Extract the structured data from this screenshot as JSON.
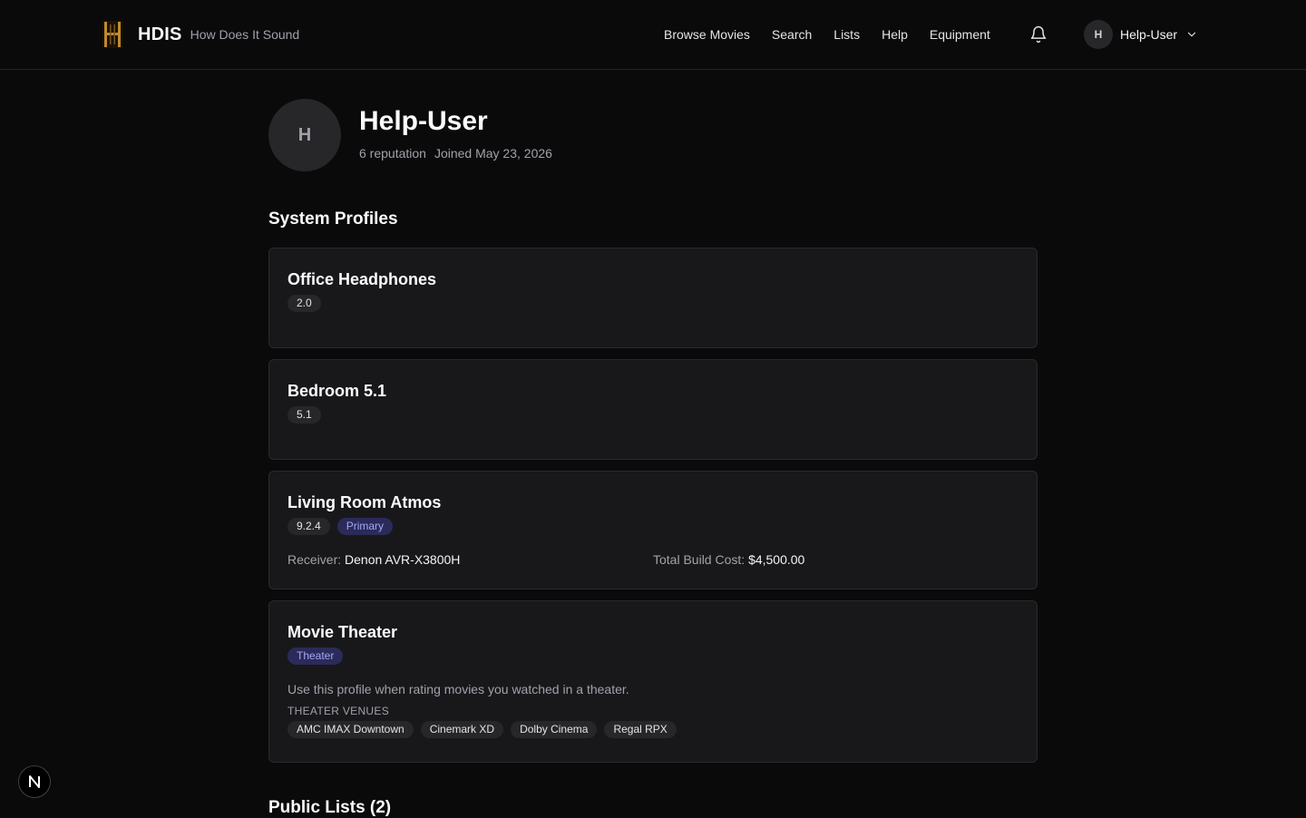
{
  "header": {
    "brand_name": "HDIS",
    "brand_tagline": "How Does It Sound",
    "nav": [
      {
        "label": "Browse Movies"
      },
      {
        "label": "Search"
      },
      {
        "label": "Lists"
      },
      {
        "label": "Help"
      },
      {
        "label": "Equipment"
      }
    ],
    "notifications_icon": "bell-icon",
    "user": {
      "initial": "H",
      "name": "Help-User",
      "menu_icon": "chevron-down-icon"
    }
  },
  "profile": {
    "initial": "H",
    "name": "Help-User",
    "reputation": "6 reputation",
    "joined": "Joined May 23, 2026"
  },
  "system_profiles": {
    "title": "System Profiles",
    "items": [
      {
        "name": "Office Headphones",
        "badges": [
          "2.0"
        ]
      },
      {
        "name": "Bedroom 5.1",
        "badges": [
          "5.1"
        ]
      },
      {
        "name": "Living Room Atmos",
        "badges": [
          "9.2.4",
          "Primary"
        ],
        "receiver_label": "Receiver:",
        "receiver_value": "Denon AVR-X3800H",
        "cost_label": "Total Build Cost:",
        "cost_value": "$4,500.00"
      },
      {
        "name": "Movie Theater",
        "badges": [
          "Theater"
        ],
        "description": "Use this profile when rating movies you watched in a theater.",
        "venues_label": "THEATER VENUES",
        "venues": [
          "AMC IMAX Downtown",
          "Cinemark XD",
          "Dolby Cinema",
          "Regal RPX"
        ]
      }
    ]
  },
  "public_lists": {
    "title": "Public Lists (2)"
  },
  "colors": {
    "background": "#0a0a0b",
    "card": "#18181b",
    "accent_badge": "#2b2a5a",
    "accent_text": "#a5a6f6"
  },
  "dev_badge": {
    "label": "N"
  }
}
